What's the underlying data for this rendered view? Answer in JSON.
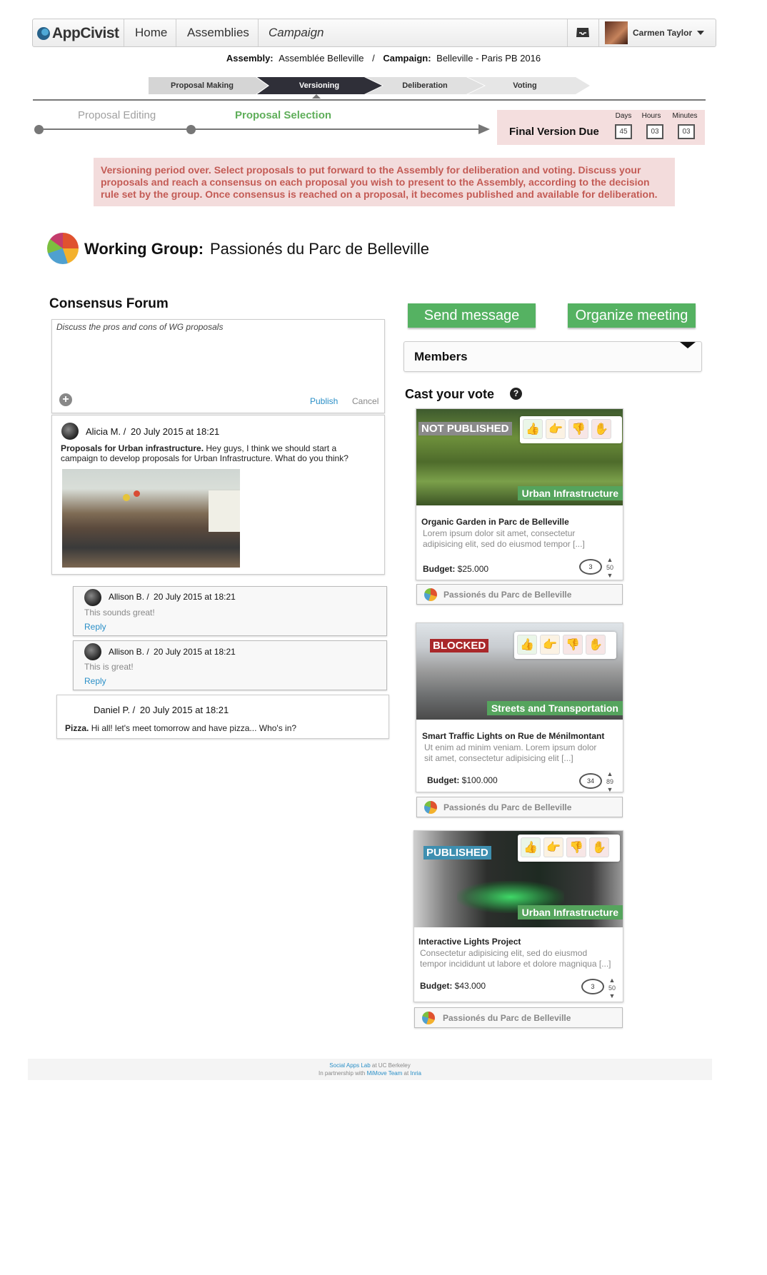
{
  "nav": {
    "logo": "AppCivist",
    "items": [
      "Home",
      "Assemblies",
      "Campaign"
    ],
    "user": "Carmen Taylor"
  },
  "breadcrumb": {
    "assembly_label": "Assembly:",
    "assembly": "Assemblée Belleville",
    "separator": "/",
    "campaign_label": "Campaign:",
    "campaign": "Belleville - Paris PB 2016"
  },
  "stages": [
    "Proposal Making",
    "Versioning",
    "Deliberation",
    "Voting"
  ],
  "substages": [
    "Proposal Editing",
    "Proposal Selection"
  ],
  "due": {
    "label": "Final Version Due",
    "units": [
      "Days",
      "Hours",
      "Minutes"
    ],
    "values": [
      "45",
      "03",
      "03"
    ]
  },
  "alert": "Versioning period over. Select proposals to put forward to the Assembly for deliberation and voting. Discuss your proposals and reach a consensus on each proposal you wish to present to the Assembly, according to the decision rule set by the group. Once consensus is reached on a proposal, it becomes published and available for deliberation.",
  "working_group": {
    "label": "Working Group:",
    "name": "Passionés du Parc de Belleville"
  },
  "forum": {
    "title": "Consensus Forum",
    "placeholder": "Discuss the pros and cons of WG proposals",
    "publish": "Publish",
    "cancel": "Cancel",
    "post": {
      "author": "Alicia M. /",
      "date": "20 July 2015 at 18:21",
      "subject": "Proposals for Urban infrastructure.",
      "body": "Hey guys, I think we should start a campaign to develop proposals for Urban Infrastructure. What do you think?"
    },
    "replies": [
      {
        "author": "Allison B. /",
        "date": "20 July 2015 at 18:21",
        "body": "This sounds great!",
        "reply": "Reply"
      },
      {
        "author": "Allison B. /",
        "date": "20 July 2015 at 18:21",
        "body": "This is great!",
        "reply": "Reply"
      }
    ],
    "post2": {
      "author": "Daniel P. /",
      "date": "20 July 2015 at 18:21",
      "subject": "Pizza.",
      "body": "Hi all! let's meet tomorrow and have pizza... Who's in?"
    }
  },
  "actions": {
    "send_message": "Send message",
    "organize_meeting": "Organize meeting"
  },
  "members_label": "Members",
  "vote_title": "Cast your vote",
  "proposals": [
    {
      "status": "NOT PUBLISHED",
      "status_color": "#8a8a8a",
      "theme": "Urban Infrastructure",
      "title": "Organic Garden in Parc de Belleville",
      "desc": "Lorem ipsum dolor sit amet, consectetur adipisicing elit, sed do eiusmod tempor [...]",
      "budget_label": "Budget:",
      "budget": "$25.000",
      "comments": "3",
      "votes": "50",
      "group": "Passionés du Parc de Belleville"
    },
    {
      "status": "BLOCKED",
      "status_color": "#a9282a",
      "theme": "Streets and Transportation",
      "title": "Smart Traffic Lights on Rue de Ménilmontant",
      "desc": "Ut enim ad minim veniam. Lorem ipsum dolor sit amet, consectetur adipisicing elit [...]",
      "budget_label": "Budget:",
      "budget": "$100.000",
      "comments": "34",
      "votes": "89",
      "group": "Passionés du Parc de Belleville"
    },
    {
      "status": "PUBLISHED",
      "status_color": "#3e8fb0",
      "theme": "Urban Infrastructure",
      "title": "Interactive Lights Project",
      "desc": "Consectetur adipisicing elit, sed do eiusmod tempor incididunt ut labore et dolore magniqua [...]",
      "budget_label": "Budget:",
      "budget": "$43.000",
      "comments": "3",
      "votes": "50",
      "group": "Passionés du Parc de Belleville"
    }
  ],
  "footer": {
    "line1_link": "Social Apps Lab",
    "line1_rest": "at UC Berkeley",
    "line2_pre": "In partnership with",
    "line2_link1": "MiMove Team",
    "line2_mid": "at",
    "line2_link2": "Inria"
  }
}
